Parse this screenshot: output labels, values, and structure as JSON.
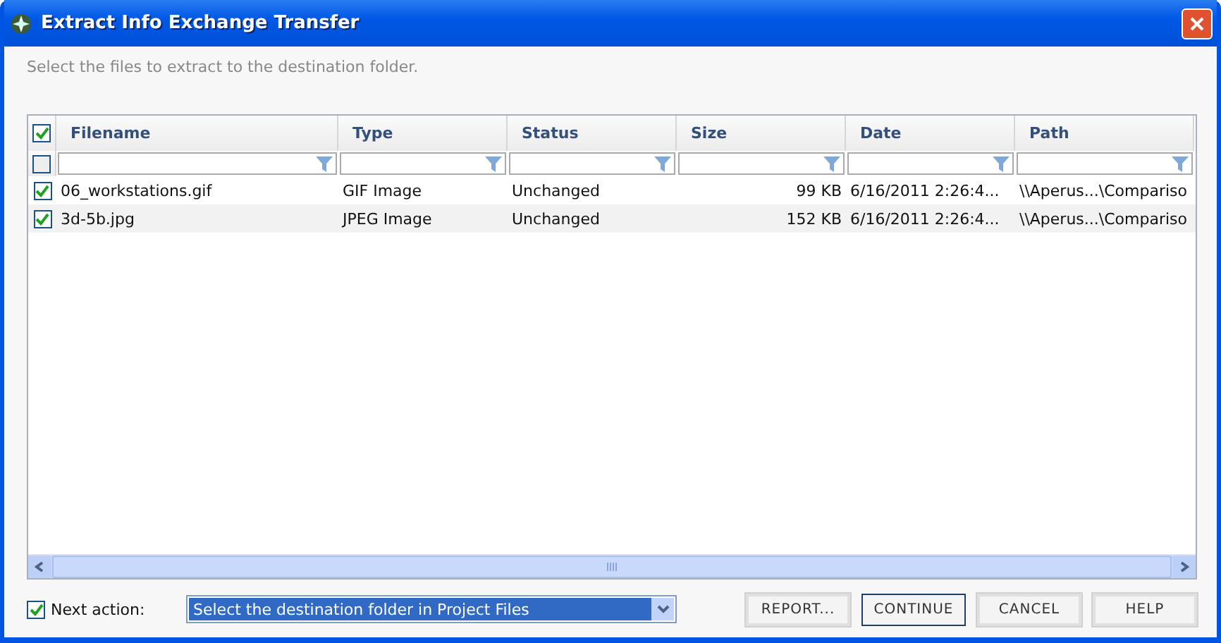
{
  "window": {
    "title": "Extract Info Exchange Transfer"
  },
  "instruction": "Select the files to extract to the destination folder.",
  "table": {
    "select_all": {
      "checked": true
    },
    "columns": [
      "Filename",
      "Type",
      "Status",
      "Size",
      "Date",
      "Path"
    ],
    "rows": [
      {
        "checked": true,
        "cells": [
          "06_workstations.gif",
          "GIF Image",
          "Unchanged",
          "99 KB",
          "6/16/2011 2:26:4...",
          "\\\\Aperus...\\Compariso"
        ]
      },
      {
        "checked": true,
        "cells": [
          "3d-5b.jpg",
          "JPEG Image",
          "Unchanged",
          "152 KB",
          "6/16/2011 2:26:4...",
          "\\\\Aperus...\\Compariso"
        ]
      }
    ]
  },
  "next_action": {
    "checked": true,
    "label": "Next action:",
    "value": "Select the destination folder in Project Files"
  },
  "buttons": [
    {
      "label": "REPORT...",
      "default": false
    },
    {
      "label": "CONTINUE",
      "default": true
    },
    {
      "label": "CANCEL",
      "default": false
    },
    {
      "label": "HELP",
      "default": false
    }
  ]
}
